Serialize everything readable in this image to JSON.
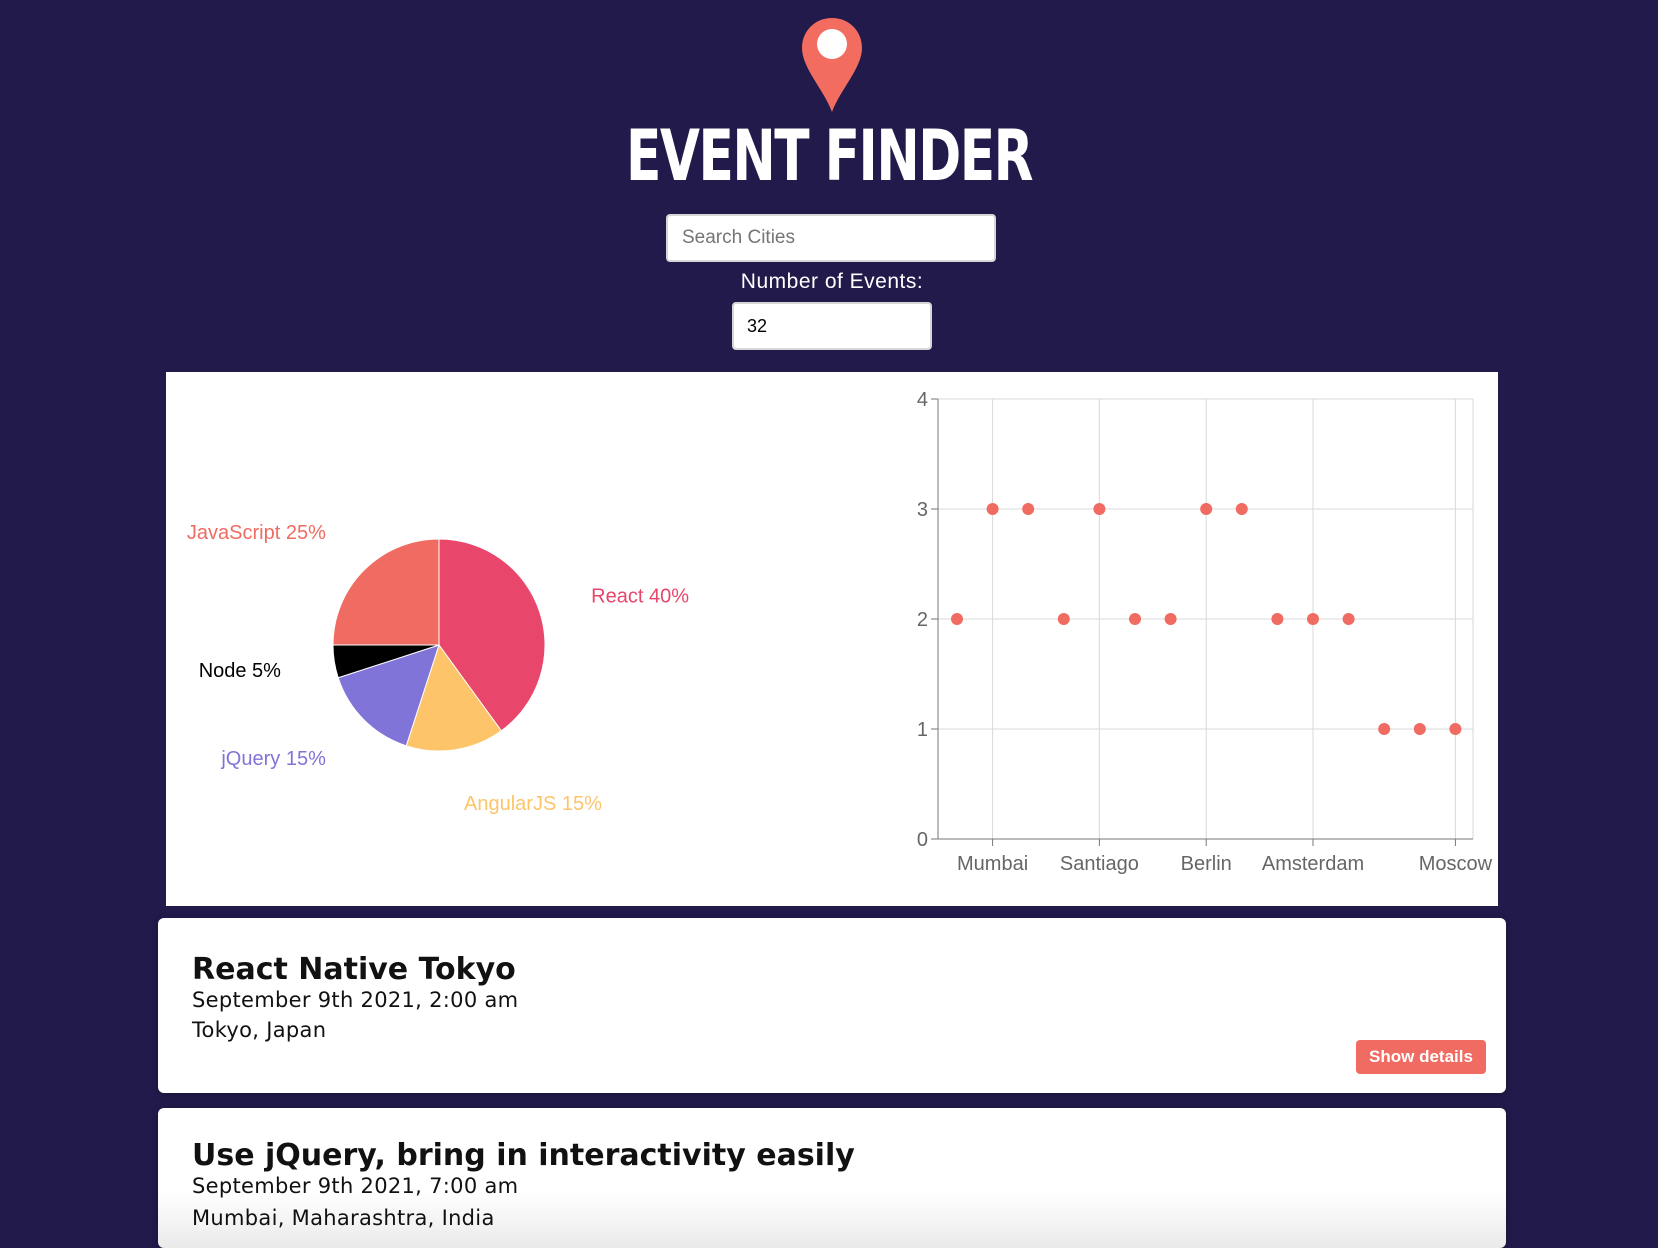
{
  "header": {
    "title": "EVENT FINDER",
    "logo_icon": "map-pin-icon",
    "accent_color": "#f26d5f"
  },
  "search": {
    "placeholder": "Search Cities",
    "value": ""
  },
  "event_count": {
    "label": "Number of Events:",
    "value": "32"
  },
  "chart_data": [
    {
      "type": "pie",
      "slices": [
        {
          "label": "React",
          "value": 40,
          "color": "#e8466b"
        },
        {
          "label": "AngularJS",
          "value": 15,
          "color": "#fdc46a"
        },
        {
          "label": "jQuery",
          "value": 15,
          "color": "#8174d8"
        },
        {
          "label": "Node",
          "value": 5,
          "color": "#000000"
        },
        {
          "label": "JavaScript",
          "value": 25,
          "color": "#f06b61"
        }
      ]
    },
    {
      "type": "scatter",
      "color": "#f06b61",
      "grid": true,
      "ylim": [
        0,
        4
      ],
      "yticks": [
        0,
        1,
        2,
        3,
        4
      ],
      "xticks": [
        "Mumbai",
        "Santiago",
        "Berlin",
        "Amsterdam",
        "Moscow"
      ],
      "y": [
        2,
        3,
        3,
        2,
        3,
        2,
        2,
        3,
        3,
        2,
        2,
        2,
        1,
        1,
        1
      ]
    }
  ],
  "events": [
    {
      "title": "React Native Tokyo",
      "date": "September 9th 2021, 2:00 am",
      "location": "Tokyo, Japan",
      "button_label": "Show details"
    },
    {
      "title": "Use jQuery, bring in interactivity easily",
      "date": "September 9th 2021, 7:00 am",
      "location": "Mumbai, Maharashtra, India"
    }
  ]
}
